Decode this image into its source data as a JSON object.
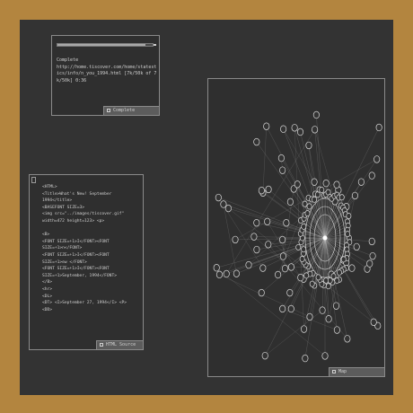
{
  "download_window": {
    "progress": 0.92,
    "status_label": "Complete",
    "url_text": "http://home.tiscover.com/home/statestics/info/n_you_1994.html [7k/50k of 7k/50k] 0:36",
    "footer_label": "Complete"
  },
  "source_window": {
    "lines": [
      "<HTML>",
      "<Title>What's New! September",
      "1994</title>",
      "<BASEFONT SIZE=3>",
      "<img src=\"../images/tiscover.gif\"",
      "width=472 height=123> <p>",
      "",
      "<B>",
      "<FONT SIZE=+1>I</FONT><FONT",
      "SIZE=+1>n</FONT>",
      "<FONT SIZE=+1>I</FONT><FONT",
      "SIZE=+1>ew </FONT>",
      "<FONT SIZE=+1>I</FONT><FONT",
      "SIZE=+1>September, 1994</FONT>",
      "</B>",
      "<hr>",
      "<DL>",
      "<DT> <I>September 27, 1994</I> <P>",
      "<DD>"
    ],
    "footer_label": "HTML Source"
  },
  "graph_window": {
    "footer_label": "Map"
  }
}
